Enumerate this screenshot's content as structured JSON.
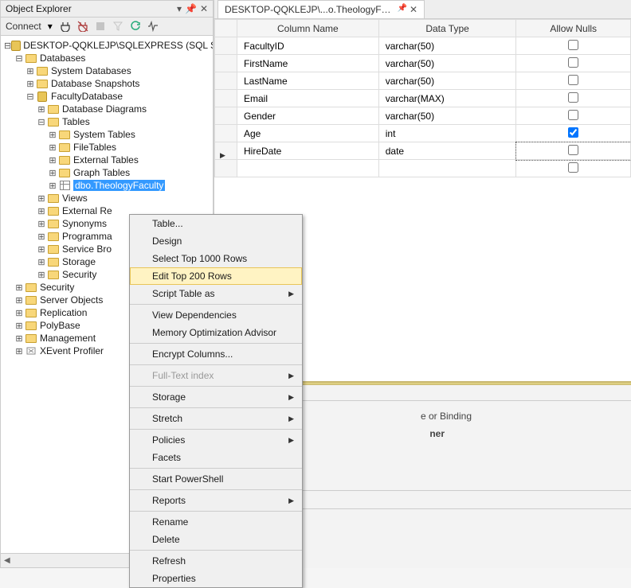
{
  "explorer": {
    "title": "Object Explorer",
    "connect_label": "Connect"
  },
  "tree": {
    "root": "DESKTOP-QQKLEJP\\SQLEXPRESS (SQL Server...)",
    "databases": "Databases",
    "sys_db": "System Databases",
    "db_snap": "Database Snapshots",
    "fac_db": "FacultyDatabase",
    "db_diag": "Database Diagrams",
    "tables": "Tables",
    "sys_tables": "System Tables",
    "file_tables": "FileTables",
    "ext_tables": "External Tables",
    "graph_tables": "Graph Tables",
    "theo": "dbo.TheologyFaculty",
    "views": "Views",
    "ext_re": "External Re",
    "syn": "Synonyms",
    "prog": "Programma",
    "svc": "Service Bro",
    "storage": "Storage",
    "security_in": "Security",
    "security": "Security",
    "srv_obj": "Server Objects",
    "repl": "Replication",
    "poly": "PolyBase",
    "mgmt": "Management",
    "xevent": "XEvent Profiler"
  },
  "tab": {
    "title": "DESKTOP-QQKLEJP\\...o.TheologyFaculty"
  },
  "grid": {
    "col_name": "Column Name",
    "col_type": "Data Type",
    "col_nulls": "Allow Nulls",
    "rows": [
      {
        "name": "FacultyID",
        "type": "varchar(50)",
        "null": false
      },
      {
        "name": "FirstName",
        "type": "varchar(50)",
        "null": false
      },
      {
        "name": "LastName",
        "type": "varchar(50)",
        "null": false
      },
      {
        "name": "Email",
        "type": "varchar(MAX)",
        "null": false
      },
      {
        "name": "Gender",
        "type": "varchar(50)",
        "null": false
      },
      {
        "name": "Age",
        "type": "int",
        "null": true
      },
      {
        "name": "HireDate",
        "type": "date",
        "null": false
      }
    ]
  },
  "lower": {
    "binding": "e or Binding",
    "ner": "ner"
  },
  "menu": {
    "new_table": "Table...",
    "design": "Design",
    "select1000": "Select Top 1000 Rows",
    "edit200": "Edit Top 200 Rows",
    "script": "Script Table as",
    "viewdep": "View Dependencies",
    "memopt": "Memory Optimization Advisor",
    "encrypt": "Encrypt Columns...",
    "fulltext": "Full-Text index",
    "storage": "Storage",
    "stretch": "Stretch",
    "policies": "Policies",
    "facets": "Facets",
    "ps": "Start PowerShell",
    "reports": "Reports",
    "rename": "Rename",
    "delete": "Delete",
    "refresh": "Refresh",
    "props": "Properties"
  }
}
